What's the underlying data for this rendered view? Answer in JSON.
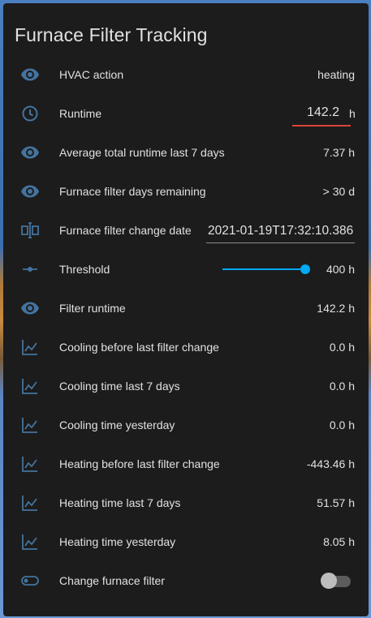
{
  "card": {
    "title": "Furnace Filter Tracking"
  },
  "rows": {
    "hvac_action": {
      "label": "HVAC action",
      "value": "heating",
      "icon": "eye-icon"
    },
    "runtime": {
      "label": "Runtime",
      "value": "142.2",
      "unit": "h",
      "icon": "clock-icon"
    },
    "avg_runtime": {
      "label": "Average total runtime last 7 days",
      "value": "7.37 h",
      "icon": "eye-icon"
    },
    "days_remaining": {
      "label": "Furnace filter days remaining",
      "value": "> 30 d",
      "icon": "eye-icon"
    },
    "change_date": {
      "label": "Furnace filter change date",
      "value": "2021-01-19T17:32:10.386",
      "icon": "text-cursor-icon"
    },
    "threshold": {
      "label": "Threshold",
      "value": "400 h",
      "level": 1.0,
      "icon": "slider-icon"
    },
    "filter_runtime": {
      "label": "Filter runtime",
      "value": "142.2 h",
      "icon": "eye-icon"
    },
    "cooling_before": {
      "label": "Cooling before last filter change",
      "value": "0.0 h",
      "icon": "chart-line-icon"
    },
    "cooling_7d": {
      "label": "Cooling time last 7 days",
      "value": "0.0 h",
      "icon": "chart-line-icon"
    },
    "cooling_yesterday": {
      "label": "Cooling time yesterday",
      "value": "0.0 h",
      "icon": "chart-line-icon"
    },
    "heating_before": {
      "label": "Heating before last filter change",
      "value": "-443.46 h",
      "icon": "chart-line-icon"
    },
    "heating_7d": {
      "label": "Heating time last 7 days",
      "value": "51.57 h",
      "icon": "chart-line-icon"
    },
    "heating_yesterday": {
      "label": "Heating time yesterday",
      "value": "8.05 h",
      "icon": "chart-line-icon"
    },
    "change_filter": {
      "label": "Change furnace filter",
      "state": "off",
      "icon": "toggle-switch-icon"
    }
  },
  "colors": {
    "icon": "#44739e",
    "accent": "#03a9f4",
    "error_underline": "#db4437",
    "card_bg": "#1c1c1c",
    "text": "#e1e1e1"
  }
}
